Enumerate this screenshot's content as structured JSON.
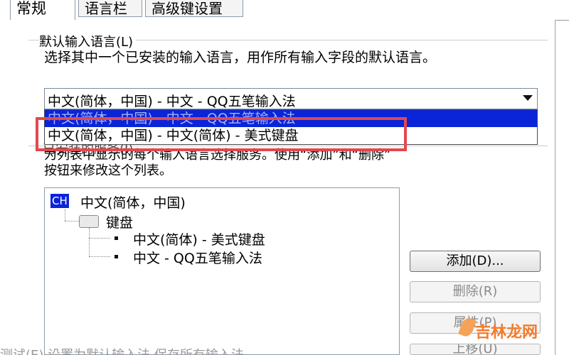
{
  "tabs": [
    "常规",
    "语言栏",
    "高级键设置"
  ],
  "default_input": {
    "group_label": "默认输入语言(L)",
    "description": "选择其中一个已安装的输入语言，用作所有输入字段的默认语言。",
    "selected": "中文(简体，中国) - 中文 - QQ五笔输入法",
    "options": [
      "中文(简体，中国) - 中文 - QQ五笔输入法",
      "中文(简体，中国) - 中文(简体) - 美式键盘"
    ]
  },
  "installed_services": {
    "group_label": "已安装的服务(I)",
    "description_line1": "为列表中显示的每个输入语言选择服务。使用“添加”和“删除”",
    "description_line2": "按钮来修改这个列表。"
  },
  "tree": {
    "badge": "CH",
    "language": "中文(简体，中国)",
    "keyboard_label": "键盘",
    "items": [
      "中文(简体) - 美式键盘",
      "中文 - QQ五笔输入法"
    ]
  },
  "buttons": {
    "add": "添加(D)...",
    "remove": "删除(R)",
    "properties": "属性(P)",
    "move_up": "上移(U)"
  },
  "bottom_text": "测试(E)   设置为默认输入法   保存所有输入法",
  "watermark": "吉林龙网"
}
